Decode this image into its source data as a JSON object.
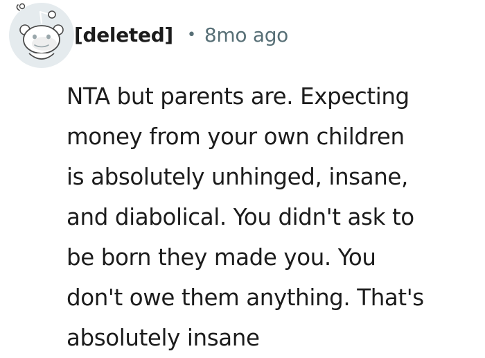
{
  "comment": {
    "author": "[deleted]",
    "separator": "•",
    "timestamp": "8mo ago",
    "avatar_icon": "reddit-snoo-icon",
    "body_lines": [
      "NTA but parents are. Expecting",
      "money from your own children",
      "is absolutely unhinged, insane,",
      "and diabolical. You didn't ask to",
      "be born they made you. You",
      "don't owe them anything. That's",
      "absolutely insane"
    ]
  },
  "colors": {
    "text": "#1c1c1c",
    "meta": "#576f76",
    "avatar_bg": "#e5ebee"
  }
}
